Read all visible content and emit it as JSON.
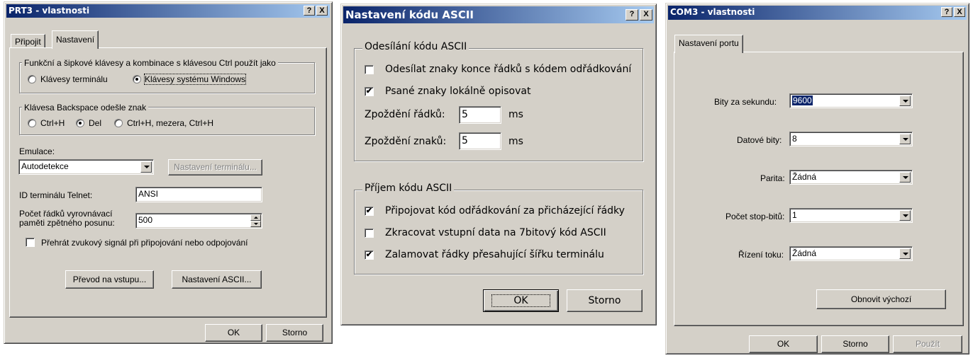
{
  "dialog1": {
    "title": "PRT3 - vlastnosti",
    "help": "?",
    "close": "X",
    "tabs": [
      "Připojit",
      "Nastavení"
    ],
    "group_keys": {
      "label": "Funkční a šipkové klávesy a kombinace s klávesou Ctrl použít jako",
      "opt1": "Klávesy terminálu",
      "opt2": "Klávesy systému Windows"
    },
    "group_backspace": {
      "label": "Klávesa Backspace odešle znak",
      "opt1": "Ctrl+H",
      "opt2": "Del",
      "opt3": "Ctrl+H, mezera, Ctrl+H"
    },
    "emulation_label": "Emulace:",
    "emulation_value": "Autodetekce",
    "terminal_settings_button": "Nastavení terminálu...",
    "telnet_id_label": "ID terminálu Telnet:",
    "telnet_id_value": "ANSI",
    "buffer_label_1": "Počet řádků vyrovnávací",
    "buffer_label_2": "paměti zpětného posunu:",
    "buffer_value": "500",
    "sound_checkbox": "Přehrát zvukový signál při připojování nebo odpojování",
    "input_translation_button": "Převod na vstupu...",
    "ascii_settings_button": "Nastavení ASCII...",
    "ok": "OK",
    "cancel": "Storno"
  },
  "dialog2": {
    "title": "Nastavení kódu ASCII",
    "help": "?",
    "close": "X",
    "send_group": "Odesílání kódu ASCII",
    "send_cb1": "Odesílat znaky konce řádků s kódem odřádkování",
    "send_cb2": "Psané znaky lokálně opisovat",
    "line_delay_label": "Zpoždění řádků:",
    "line_delay_value": "5",
    "char_delay_label": "Zpoždění znaků:",
    "char_delay_value": "5",
    "unit": "ms",
    "recv_group": "Příjem kódu ASCII",
    "recv_cb1": "Připojovat kód odřádkování za přicházející řádky",
    "recv_cb2": "Zkracovat vstupní data na 7bitový kód ASCII",
    "recv_cb3": "Zalamovat řádky přesahující šířku terminálu",
    "ok": "OK",
    "cancel": "Storno"
  },
  "dialog3": {
    "title": "COM3 - vlastnosti",
    "help": "?",
    "close": "X",
    "tab": "Nastavení portu",
    "bps_label": "Bity za sekundu:",
    "bps_value": "9600",
    "data_bits_label": "Datové bity:",
    "data_bits_value": "8",
    "parity_label": "Parita:",
    "parity_value": "Žádná",
    "stop_bits_label": "Počet stop-bitů:",
    "stop_bits_value": "1",
    "flow_label": "Řízení toku:",
    "flow_value": "Žádná",
    "restore_button": "Obnovit výchozí",
    "ok": "OK",
    "cancel": "Storno",
    "apply": "Použít"
  }
}
